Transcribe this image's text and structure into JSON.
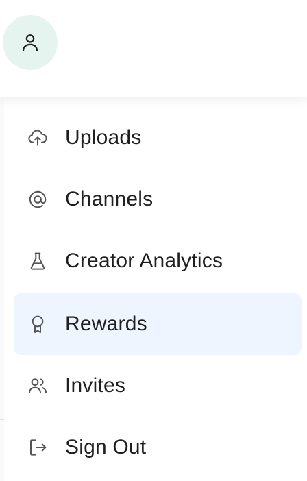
{
  "header": {
    "profile_icon": "user-icon",
    "accent_color": "#e6f4ef"
  },
  "menu": {
    "active_background": "#eef5ff",
    "items": [
      {
        "label": "Uploads",
        "icon": "cloud-upload-icon"
      },
      {
        "label": "Channels",
        "icon": "at-sign-icon"
      },
      {
        "label": "Creator Analytics",
        "icon": "flask-icon"
      },
      {
        "label": "Rewards",
        "icon": "award-icon",
        "active": true
      },
      {
        "label": "Invites",
        "icon": "users-icon"
      },
      {
        "label": "Sign Out",
        "icon": "sign-out-icon"
      }
    ]
  }
}
